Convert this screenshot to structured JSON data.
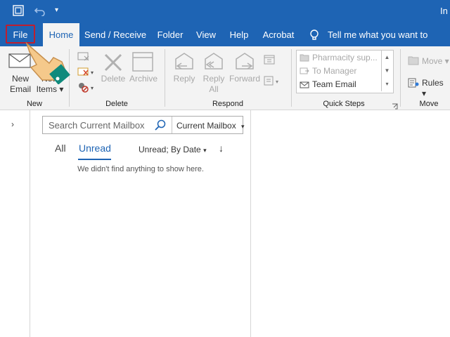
{
  "titlebar": {
    "title_fragment": "In"
  },
  "tabs": [
    {
      "label": "File"
    },
    {
      "label": "Home"
    },
    {
      "label": "Send / Receive"
    },
    {
      "label": "Folder"
    },
    {
      "label": "View"
    },
    {
      "label": "Help"
    },
    {
      "label": "Acrobat"
    }
  ],
  "tell_me": "Tell me what you want to do",
  "ribbon": {
    "new": {
      "new_email_1": "New",
      "new_email_2": "Email",
      "new_items_1": "New",
      "new_items_2": "Items",
      "group": "New"
    },
    "delete": {
      "delete": "Delete",
      "archive": "Archive",
      "group": "Delete"
    },
    "respond": {
      "reply": "Reply",
      "reply_all_1": "Reply",
      "reply_all_2": "All",
      "forward": "Forward",
      "group": "Respond"
    },
    "quick_steps": {
      "items": [
        "Pharmacity sup...",
        "To Manager",
        "Team Email"
      ],
      "group": "Quick Steps"
    },
    "move": {
      "move": "Move",
      "rules": "Rules",
      "group": "Move"
    }
  },
  "search": {
    "placeholder": "Search Current Mailbox",
    "scope": "Current Mailbox"
  },
  "filters": {
    "all": "All",
    "unread": "Unread",
    "sort": "Unread; By Date"
  },
  "empty_message": "We didn't find anything to show here.",
  "colors": {
    "brand": "#1e64b4",
    "highlight_box": "#c01e2e"
  }
}
